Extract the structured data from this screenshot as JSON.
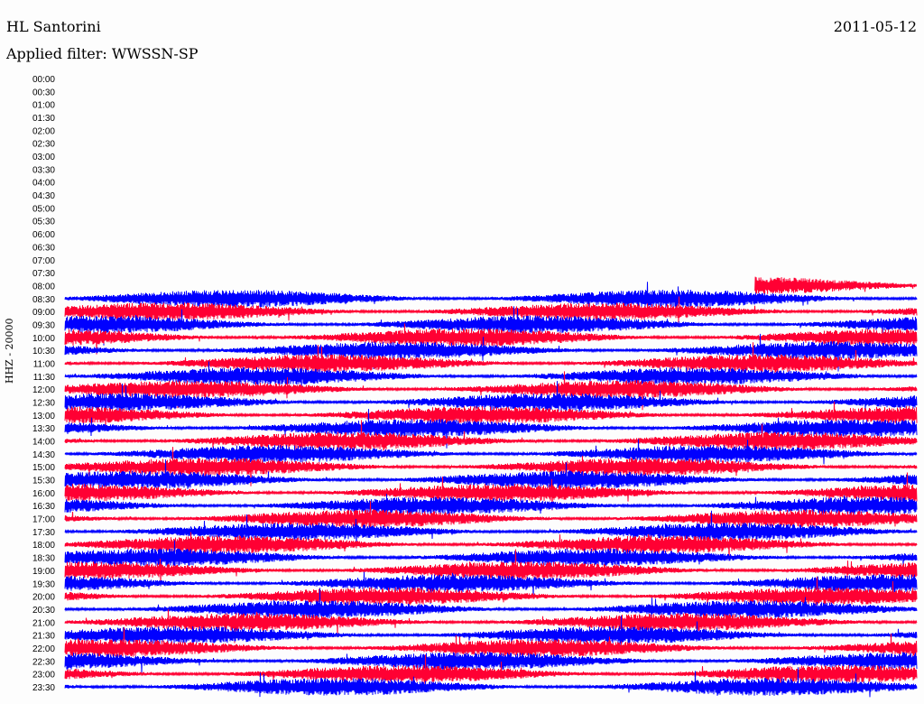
{
  "header": {
    "station": "HL Santorini",
    "date": "2011-05-12",
    "filter": "Applied filter: WWSSN-SP"
  },
  "chart_data": {
    "type": "line",
    "subtype": "helicorder",
    "title": "HL Santorini",
    "date": "2011-05-12",
    "filter": "WWSSN-SP",
    "ylabel": "HHZ - 20000",
    "row_interval_minutes": 30,
    "y_ticks": [
      "00:00",
      "00:30",
      "01:00",
      "01:30",
      "02:00",
      "02:30",
      "03:00",
      "03:30",
      "04:00",
      "04:30",
      "05:00",
      "05:30",
      "06:00",
      "06:30",
      "07:00",
      "07:30",
      "08:00",
      "08:30",
      "09:00",
      "09:30",
      "10:00",
      "10:30",
      "11:00",
      "11:30",
      "12:00",
      "12:30",
      "13:00",
      "13:30",
      "14:00",
      "14:30",
      "15:00",
      "15:30",
      "16:00",
      "16:30",
      "17:00",
      "17:30",
      "18:00",
      "18:30",
      "19:00",
      "19:30",
      "20:00",
      "20:30",
      "21:00",
      "21:30",
      "22:00",
      "22:30",
      "23:00",
      "23:30"
    ],
    "first_trace_row": "08:00",
    "first_trace_start_fraction": 0.81,
    "series_colors": [
      "#ff0033",
      "#0000ff"
    ],
    "relative_amplitude": 0.9
  }
}
